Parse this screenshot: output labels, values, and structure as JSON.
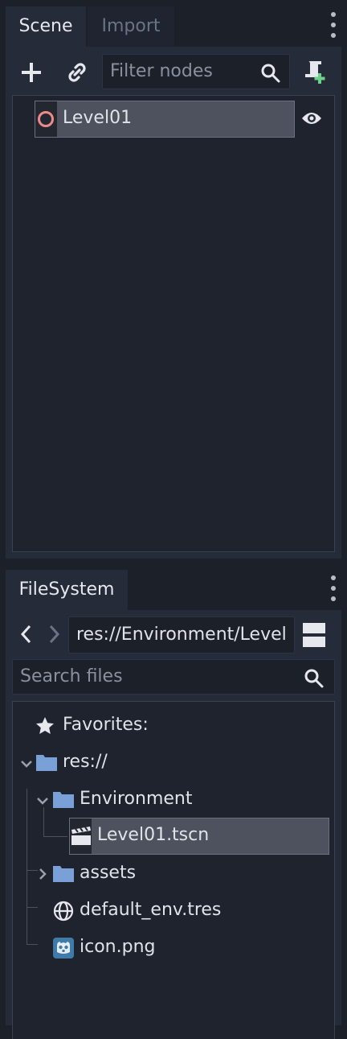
{
  "scene_dock": {
    "tabs": [
      {
        "label": "Scene",
        "active": true
      },
      {
        "label": "Import",
        "active": false
      }
    ],
    "toolbar": {
      "add_icon": "plus-icon",
      "link_icon": "link-icon",
      "filter_placeholder": "Filter nodes",
      "search_icon": "search-icon",
      "script_icon": "add-script-icon"
    },
    "tree": {
      "root": {
        "label": "Level01",
        "icon": "node-circle-icon",
        "icon_color": "#f08a8a",
        "visibility_icon": "eye-icon"
      }
    }
  },
  "filesystem_dock": {
    "tabs": [
      {
        "label": "FileSystem",
        "active": true
      }
    ],
    "path": "res://Environment/Level",
    "search_placeholder": "Search files",
    "tree": [
      {
        "label": "Favorites:",
        "icon": "star-icon"
      },
      {
        "label": "res://",
        "icon": "folder-icon",
        "expanded": true
      },
      {
        "label": "Environment",
        "icon": "folder-icon",
        "expanded": true
      },
      {
        "label": "Level01.tscn",
        "icon": "clapperboard-icon",
        "selected": true
      },
      {
        "label": "assets",
        "icon": "folder-icon",
        "expanded": false
      },
      {
        "label": "default_env.tres",
        "icon": "globe-icon"
      },
      {
        "label": "icon.png",
        "icon": "godot-icon"
      }
    ]
  },
  "colors": {
    "folder": "#7aa0d8",
    "accent_green": "#6fd08c",
    "node_red": "#f08a8a"
  }
}
